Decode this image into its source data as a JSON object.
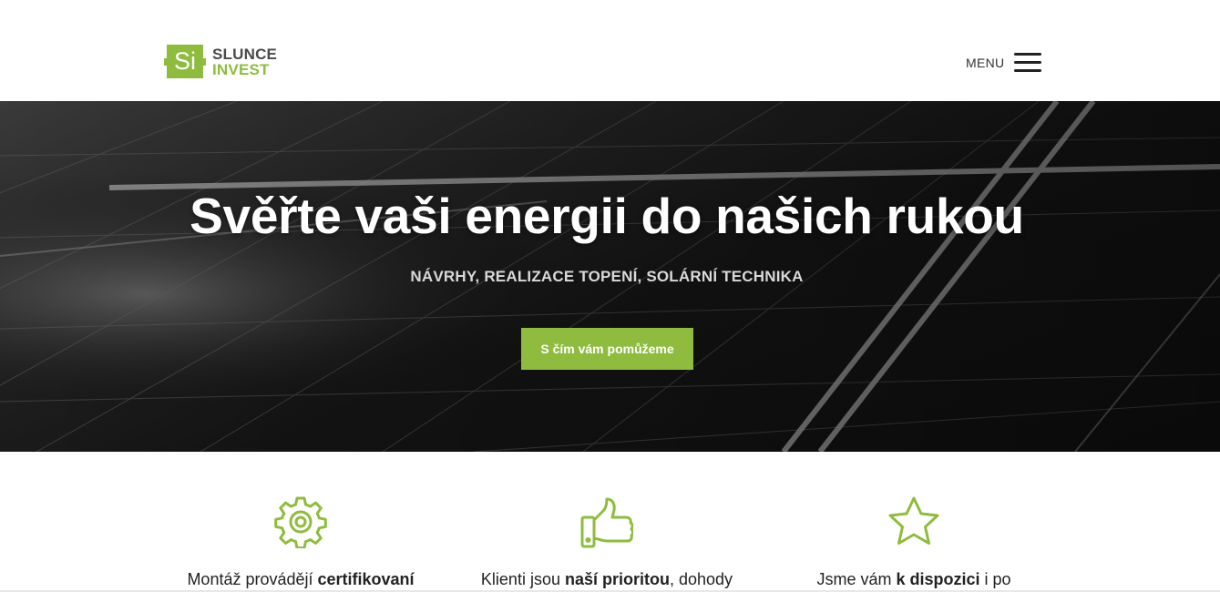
{
  "header": {
    "logo": {
      "badge": "Si",
      "line1": "SLUNCE",
      "line2": "INVEST"
    },
    "menu_label": "MENU"
  },
  "hero": {
    "title": "Svěřte vaši energii do našich rukou",
    "subtitle": "NÁVRHY, REALIZACE TOPENÍ, SOLÁRNÍ TECHNIKA",
    "button_label": "S čím vám pomůžeme"
  },
  "features": [
    {
      "icon": "gear-icon",
      "text_before": "Montáž provádějí ",
      "text_bold": "certifikovaní",
      "text_after": ""
    },
    {
      "icon": "thumbs-up-icon",
      "text_before": "Klienti jsou ",
      "text_bold": "naší prioritou",
      "text_after": ", dohody"
    },
    {
      "icon": "star-icon",
      "text_before": "Jsme vám ",
      "text_bold": "k dispozici",
      "text_after": " i po"
    }
  ],
  "colors": {
    "accent": "#8fbc3f",
    "hero_dark": "#141414",
    "text": "#222222"
  }
}
